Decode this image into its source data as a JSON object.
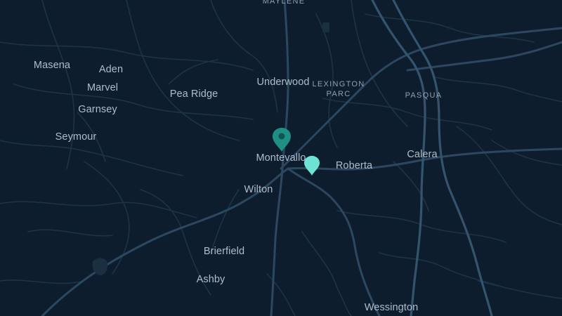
{
  "map": {
    "colors": {
      "background": "#0e1d2d",
      "road_major": "#2e4b63",
      "road_minor": "#1e3447",
      "label": "#aebdcc",
      "pin_primary": "#1f8f86",
      "pin_secondary": "#6fe3d3"
    },
    "labels": {
      "maylene": "MAYLENE",
      "masena": "Masena",
      "aden": "Aden",
      "marvel": "Marvel",
      "pea_ridge": "Pea Ridge",
      "underwood": "Underwood",
      "lexington_parc_1": "LEXINGTON",
      "lexington_parc_2": "PARC",
      "pasqua": "PASQUA",
      "garnsey": "Garnsey",
      "seymour": "Seymour",
      "montevallo": "Montevallo",
      "calera": "Calera",
      "roberta": "Roberta",
      "wilton": "Wilton",
      "brierfield": "Brierfield",
      "ashby": "Ashby",
      "wessington": "Wessington"
    },
    "pins": {
      "primary": "map-pin-icon",
      "secondary": "map-pin-icon"
    }
  }
}
